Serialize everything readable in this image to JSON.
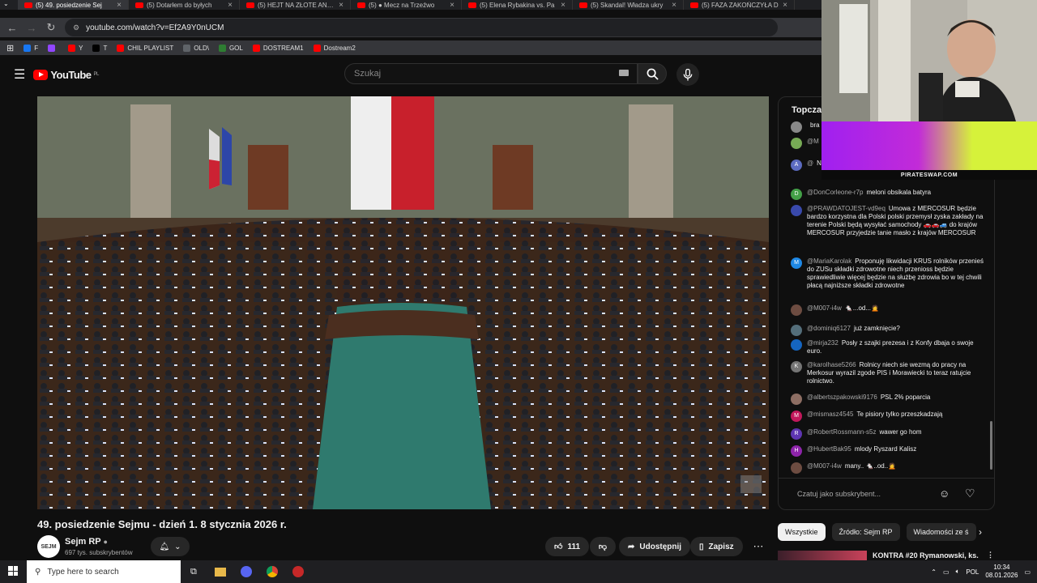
{
  "tabs": [
    {
      "title": "(5) 49. posiedzenie Sej",
      "active": true
    },
    {
      "title": "(5) Dotarłem do byłych",
      "active": false
    },
    {
      "title": "(5) HEJT NA ZŁOTE ANTO",
      "active": false
    },
    {
      "title": "(5) ● Mecz na Trzeźwo",
      "active": false
    },
    {
      "title": "(5) Elena Rybakina vs. Pa",
      "active": false
    },
    {
      "title": "(5) Skandal! Władza ukry",
      "active": false
    },
    {
      "title": "(5) FAZA ZAKOŃCZYŁA D",
      "active": false
    }
  ],
  "browser": {
    "url": "youtube.com/watch?v=Ef2A9Y0nUCM"
  },
  "bookmarks": [
    {
      "label": "F",
      "color": "#1877f2"
    },
    {
      "label": "",
      "color": "#9146ff"
    },
    {
      "label": "Y",
      "color": "#ff0000"
    },
    {
      "label": "T",
      "color": "#000000"
    },
    {
      "label": "CHIL PLAYLIST",
      "color": "#ff0000"
    },
    {
      "label": "OLD\\",
      "color": "#5f6368"
    },
    {
      "label": "GOL",
      "color": "#2e7d32"
    },
    {
      "label": "DOSTREAM1",
      "color": "#ff0000"
    },
    {
      "label": "Dostream2",
      "color": "#ff0000"
    }
  ],
  "yt": {
    "logo": "YouTube",
    "country": "PL",
    "search_placeholder": "Szukaj"
  },
  "video": {
    "title": "49. posiedzenie Sejmu - dzień 1. 8 stycznia 2026 r."
  },
  "channel": {
    "name": "Sejm RP",
    "subs": "697 tys. subskrybentów",
    "avatar_text": "SEJM"
  },
  "actions": {
    "likes": "111",
    "share": "Udostępnij",
    "save": "Zapisz"
  },
  "chat": {
    "header": "Topczat",
    "input_placeholder": "Czatuj jako subskrybent...",
    "messages": [
      {
        "author": "",
        "text": "bra",
        "avatar_color": "#888",
        "avatar_letter": ""
      },
      {
        "author": "@M",
        "text": "",
        "avatar_color": "#7a5",
        "avatar_letter": ""
      },
      {
        "author": "@",
        "text": "Nie",
        "avatar_color": "#5c6bc0",
        "avatar_letter": "A"
      },
      {
        "author": "@DonCorleone-r7p",
        "text": "meloni obsikala batyra",
        "avatar_color": "#43a047",
        "avatar_letter": "D"
      },
      {
        "author": "@PRAWDATOJEST-vd9eq",
        "text": "Umowa z MERCOSUR będzie bardzo korzystna dla Polski polski przemysł zyska zakłady na terenie Polski będą wysyłać samochody 🚗🚗🚙 do krajów MERCOSUR przyjedzie tanie masło z krajów MERCOSUR",
        "avatar_color": "#3949ab",
        "avatar_letter": ""
      },
      {
        "author": "@MariaKarolak",
        "text": "Proponuję likwidacji KRUS rolników przenieś do ZUSu składki zdrowotne niech przenioss będzie sprawiedliwie więcej będzie na służbę zdrowia bo w tej chwili płacą najniższe składki zdrowotne",
        "avatar_color": "#1e88e5",
        "avatar_letter": "M"
      },
      {
        "author": "@M007-i4w",
        "text": "🐁...od...🙍",
        "avatar_color": "#6d4c41",
        "avatar_letter": ""
      },
      {
        "author": "@dominiq6127",
        "text": "już zamknięcie?",
        "avatar_color": "#546e7a",
        "avatar_letter": ""
      },
      {
        "author": "@mirja232",
        "text": "Posły z szajki prezesa i z Konfy dbaja o swoje euro.",
        "avatar_color": "#1565c0",
        "avatar_letter": ""
      },
      {
        "author": "@karolhase5266",
        "text": "Rolnicy niech sie wezmą do pracy na Merkosur wyrazil zgode PIS i Morawiecki to teraz ratujcie rolnictwo.",
        "avatar_color": "#757575",
        "avatar_letter": "K"
      },
      {
        "author": "@albertszpakowski9176",
        "text": "PSL 2% poparcia",
        "avatar_color": "#8d6e63",
        "avatar_letter": ""
      },
      {
        "author": "@mismasz4545",
        "text": "Te pisiory tylko przeszkadzają",
        "avatar_color": "#c2185b",
        "avatar_letter": "M"
      },
      {
        "author": "@RobertRossmann-s5z",
        "text": "wawer go hom",
        "avatar_color": "#5e35b1",
        "avatar_letter": "R"
      },
      {
        "author": "@HubertBak95",
        "text": "mlody Ryszard Kalisz",
        "avatar_color": "#8e24aa",
        "avatar_letter": "H"
      },
      {
        "author": "@M007-i4w",
        "text": "many.. 🐁..od..🙍",
        "avatar_color": "#6d4c41",
        "avatar_letter": ""
      }
    ]
  },
  "chips": [
    "Wszystkie",
    "Źródło: Sejm RP",
    "Wiadomości ze ś"
  ],
  "rec": {
    "title": "KONTRA #20 Rymanowski, ks."
  },
  "stream": {
    "banner": "PIRATESWAP.COM"
  },
  "taskbar": {
    "search": "Type here to search",
    "lang": "POL",
    "time": "10:34",
    "date": "08.01.2026"
  },
  "colors": {
    "accent": "#ff0000",
    "chip_selected": "#f1f1f1",
    "banner": "#d6f23a"
  }
}
